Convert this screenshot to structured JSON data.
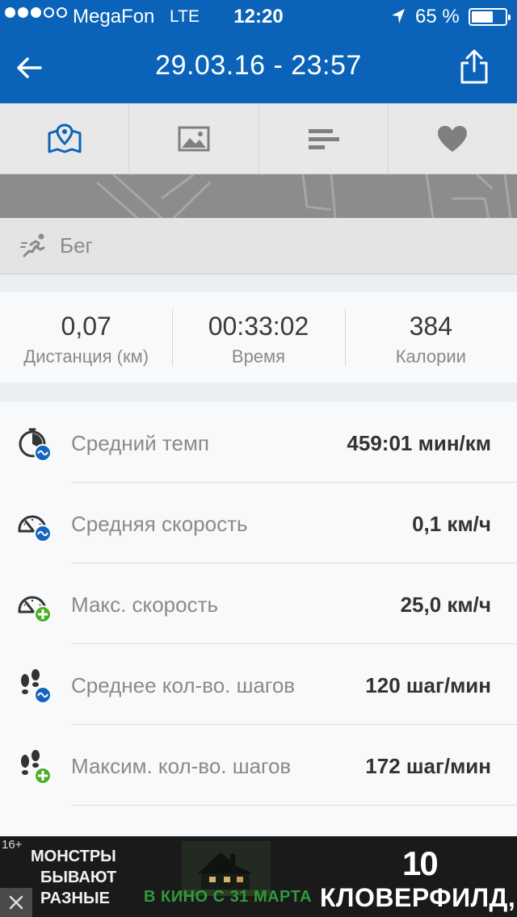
{
  "status_bar": {
    "carrier": "MegaFon",
    "network": "LTE",
    "time": "12:20",
    "battery_percent": "65 %",
    "battery_level": 0.65,
    "signal_bars": 3
  },
  "header": {
    "title": "29.03.16 - 23:57"
  },
  "tabs": [
    {
      "icon": "map-icon",
      "active": true
    },
    {
      "icon": "image-icon",
      "active": false
    },
    {
      "icon": "bar-chart-icon",
      "active": false
    },
    {
      "icon": "heart-icon",
      "active": false
    }
  ],
  "activity": {
    "label": "Бег",
    "icon": "running-icon"
  },
  "summary": [
    {
      "value": "0,07",
      "label": "Дистанция (км)"
    },
    {
      "value": "00:33:02",
      "label": "Время"
    },
    {
      "value": "384",
      "label": "Калории"
    }
  ],
  "stats": [
    {
      "label": "Средний темп",
      "value": "459:01 мин/км",
      "icon": "pace-average-icon"
    },
    {
      "label": "Средняя скорость",
      "value": "0,1 км/ч",
      "icon": "speed-average-icon"
    },
    {
      "label": "Макс. скорость",
      "value": "25,0 км/ч",
      "icon": "speed-max-icon"
    },
    {
      "label": "Среднее кол-во. шагов",
      "value": "120 шаг/мин",
      "icon": "steps-average-icon"
    },
    {
      "label": "Максим. кол-во. шагов",
      "value": "172 шаг/мин",
      "icon": "steps-max-icon"
    }
  ],
  "ad": {
    "age_rating": "16+",
    "slogan_line1": "МОНСТРЫ",
    "slogan_line2": "БЫВАЮТ",
    "slogan_line3": "РАЗНЫЕ",
    "release": "В КИНО С 31 МАРТА",
    "number": "10",
    "title": "КЛОВЕРФИЛД,"
  },
  "colors": {
    "brand_blue": "#0a63b8",
    "badge_blue": "#1565c0",
    "badge_green": "#4caf2a"
  }
}
